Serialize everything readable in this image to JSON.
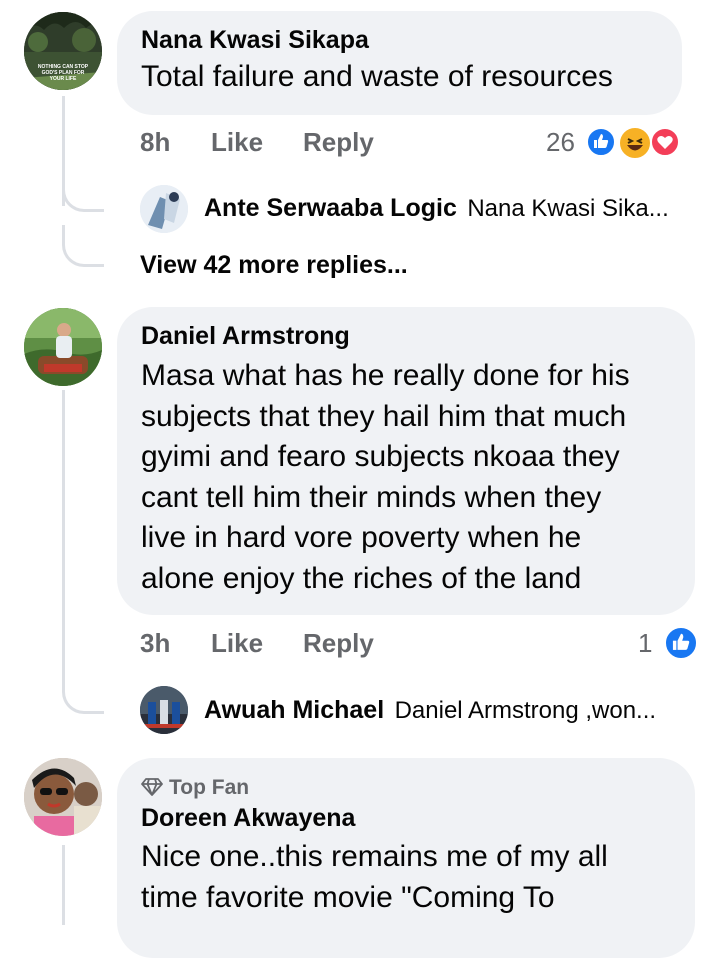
{
  "comments": [
    {
      "author": "Nana Kwasi Sikapa",
      "text": "Total failure and waste of resources",
      "time": "8h",
      "like_label": "Like",
      "reply_label": "Reply",
      "reaction_count": "26",
      "reactions": [
        "like-icon",
        "haha-icon",
        "love-icon"
      ],
      "avatar_caption": "NOTHING CAN STOP GOD'S PLAN FOR YOUR LIFE",
      "replies_preview": {
        "author": "Ante Serwaaba Logic",
        "snippet": "Nana Kwasi Sika..."
      },
      "more_replies": "View 42 more replies..."
    },
    {
      "author": "Daniel Armstrong",
      "text_lines": [
        "Masa what has he really done for his",
        "subjects that they hail him that much",
        "gyimi and fearo subjects nkoaa they",
        "cant tell him their minds when they",
        "live in hard vore poverty when he",
        "alone enjoy the riches of the land"
      ],
      "time": "3h",
      "like_label": "Like",
      "reply_label": "Reply",
      "reaction_count": "1",
      "reactions": [
        "like-icon"
      ],
      "replies_preview": {
        "author": "Awuah Michael",
        "snippet": "Daniel Armstrong ,won..."
      }
    },
    {
      "badge": "Top Fan",
      "author": "Doreen Akwayena",
      "text_lines": [
        "Nice one..this remains me of my all",
        "time favorite movie \"Coming To"
      ]
    }
  ],
  "colors": {
    "bubble": "#f0f2f5",
    "meta": "#65676b",
    "like_blue": "#1877f2",
    "love_red": "#f33e58",
    "haha_yellow": "#f7b125",
    "thread_line": "#dcdfe4"
  }
}
